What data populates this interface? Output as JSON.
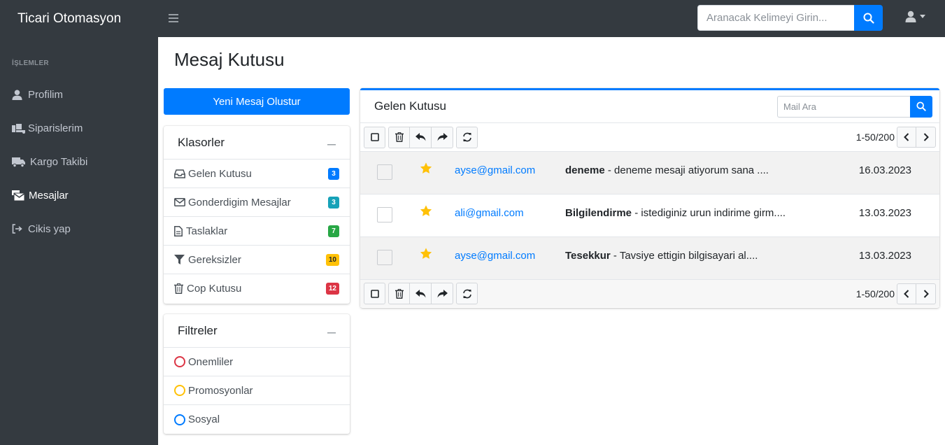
{
  "brand": "Ticari Otomasyon",
  "search": {
    "placeholder": "Aranacak Kelimeyi Girin..."
  },
  "sidebar": {
    "header": "İŞLEMLER",
    "items": [
      {
        "label": "Profilim",
        "icon": "user-icon"
      },
      {
        "label": "Siparislerim",
        "icon": "dolly-icon"
      },
      {
        "label": "Kargo Takibi",
        "icon": "truck-icon"
      },
      {
        "label": "Mesajlar",
        "icon": "mail-bulk-icon",
        "active": true
      },
      {
        "label": "Cikis yap",
        "icon": "sign-out-icon"
      }
    ]
  },
  "page": {
    "title": "Mesaj Kutusu"
  },
  "compose": {
    "label": "Yeni Mesaj Olustur"
  },
  "folders": {
    "title": "Klasorler",
    "items": [
      {
        "label": "Gelen Kutusu",
        "count": "3",
        "color": "#007bff"
      },
      {
        "label": "Gonderdigim Mesajlar",
        "count": "3",
        "color": "#17a2b8"
      },
      {
        "label": "Taslaklar",
        "count": "7",
        "color": "#28a745"
      },
      {
        "label": "Gereksizler",
        "count": "10",
        "color": "#ffc107"
      },
      {
        "label": "Cop Kutusu",
        "count": "12",
        "color": "#dc3545"
      }
    ]
  },
  "filters": {
    "title": "Filtreler",
    "items": [
      {
        "label": "Onemliler",
        "color": "#dc3545"
      },
      {
        "label": "Promosyonlar",
        "color": "#ffc107"
      },
      {
        "label": "Sosyal",
        "color": "#007bff"
      }
    ]
  },
  "inbox": {
    "title": "Gelen Kutusu",
    "search_placeholder": "Mail Ara",
    "pager": "1-50/200",
    "mails": [
      {
        "from": "ayse@gmail.com",
        "subject": "deneme",
        "preview": " - deneme mesaji atiyorum sana ....",
        "date": "16.03.2023",
        "starred": true
      },
      {
        "from": "ali@gmail.com",
        "subject": "Bilgilendirme",
        "preview": " - istediginiz urun indirime girm....",
        "date": "13.03.2023",
        "starred": true
      },
      {
        "from": "ayse@gmail.com",
        "subject": "Tesekkur",
        "preview": " - Tavsiye ettigin bilgisayari al....",
        "date": "13.03.2023",
        "starred": true
      }
    ]
  },
  "colors": {
    "primary": "#007bff",
    "sidebar_bg": "#343a40",
    "star": "#ffc107"
  }
}
